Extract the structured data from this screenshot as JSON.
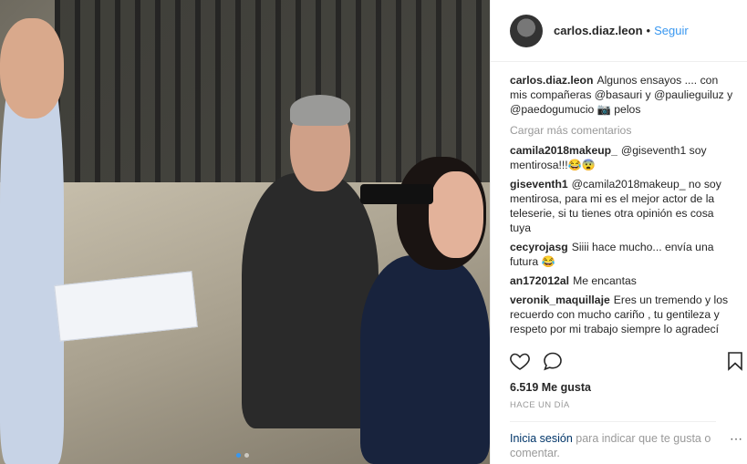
{
  "post": {
    "username": "carlos.diaz.leon",
    "separator": "•",
    "follow_label": "Seguir",
    "caption_text": "Algunos ensayos .... con mis compañeras @basauri y @paulieguiluz y @paedogumucio 📷 pelos",
    "load_more_label": "Cargar más comentarios",
    "likes_text": "6.519 Me gusta",
    "time_ago": "HACE UN DÍA",
    "login_prompt_link": "Inicia sesión",
    "login_prompt_rest": "para indicar que te gusta o comentar.",
    "more_icon": "⋯"
  },
  "comments": [
    {
      "user": "camila2018makeup_",
      "text": "@giseventh1 soy mentirosa!!!😂😨"
    },
    {
      "user": "giseventh1",
      "text": "@camila2018makeup_ no soy mentirosa, para mi es el mejor actor de la teleserie, si tu tienes otra opinión es cosa tuya"
    },
    {
      "user": "cecyrojasg",
      "text": "Siiii hace mucho... envía una futura 😂"
    },
    {
      "user": "an172012al",
      "text": "Me encantas"
    },
    {
      "user": "veronik_maquillaje",
      "text": "Eres un tremendo y los recuerdo con mucho cariño , tu gentileza y respeto por mi trabajo siempre lo agradecí"
    }
  ],
  "icons": {
    "like": "heart-icon",
    "comment": "comment-bubble-icon",
    "save": "bookmark-icon"
  },
  "carousel": {
    "total": 2,
    "active": 1
  }
}
